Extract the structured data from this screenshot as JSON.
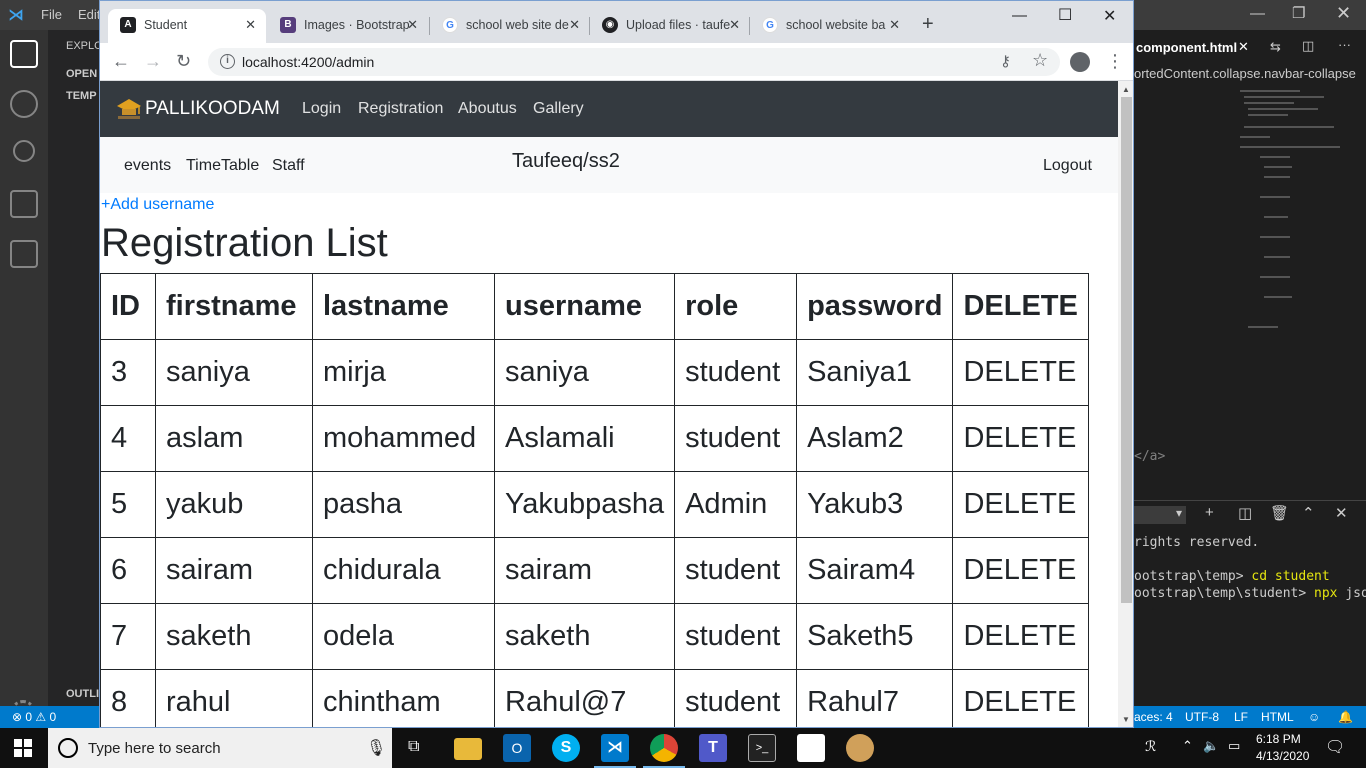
{
  "vscode": {
    "menu_file": "File",
    "menu_edit": "Edit",
    "explorer_label": "EXPLO",
    "open_editors_label": "OPEN",
    "temp_label": "TEMP",
    "outline_label": "OUTLI",
    "editor_tab": "component.html",
    "breadcrumb": "ortedContent.collapse.navbar-collapse",
    "code_snippet": "</a>",
    "terminal_lines": [
      "rights reserved.",
      "ootstrap\\temp> ",
      "ootstrap\\temp\\student> "
    ],
    "terminal_cmd1": "cd student",
    "terminal_cmd2": "npx",
    "terminal_cmd2_rest": " json",
    "status_errors": "0",
    "status_warnings": "0",
    "status_spaces": "aces: 4",
    "status_encoding": "UTF-8",
    "status_eol": "LF",
    "status_lang": "HTML",
    "badge_count": "1"
  },
  "chrome": {
    "tabs": [
      {
        "label": "Student",
        "icon": "angular-icon",
        "color": "#202124"
      },
      {
        "label": "Images · Bootstrap",
        "icon": "bootstrap-icon",
        "color": "#563d7c"
      },
      {
        "label": "school web site de",
        "icon": "google-icon",
        "color": "#4285f4"
      },
      {
        "label": "Upload files · taufe",
        "icon": "github-icon",
        "color": "#202124"
      },
      {
        "label": "school website ba",
        "icon": "google-icon",
        "color": "#4285f4"
      }
    ],
    "url": "localhost:4200/admin"
  },
  "page": {
    "brand": "PALLIKOODAM",
    "nav": {
      "login": "Login",
      "registration": "Registration",
      "aboutus": "Aboutus",
      "gallery": "Gallery"
    },
    "subnav": {
      "events": "events",
      "timetable": "TimeTable",
      "staff": "Staff",
      "title": "Taufeeq/ss2",
      "logout": "Logout"
    },
    "add_link": "+Add username",
    "heading": "Registration List",
    "table": {
      "headers": [
        "ID",
        "firstname",
        "lastname",
        "username",
        "role",
        "password",
        "DELETE"
      ],
      "rows": [
        [
          "3",
          "saniya",
          "mirja",
          "saniya",
          "student",
          "Saniya1",
          "DELETE"
        ],
        [
          "4",
          "aslam",
          "mohammed",
          "Aslamali",
          "student",
          "Aslam2",
          "DELETE"
        ],
        [
          "5",
          "yakub",
          "pasha",
          "Yakubpasha",
          "Admin",
          "Yakub3",
          "DELETE"
        ],
        [
          "6",
          "sairam",
          "chidurala",
          "sairam",
          "student",
          "Sairam4",
          "DELETE"
        ],
        [
          "7",
          "saketh",
          "odela",
          "saketh",
          "student",
          "Saketh5",
          "DELETE"
        ],
        [
          "8",
          "rahul",
          "chintham",
          "Rahul@7",
          "student",
          "Rahul7",
          "DELETE"
        ]
      ]
    }
  },
  "taskbar": {
    "search_placeholder": "Type here to search",
    "time": "6:18 PM",
    "date": "4/13/2020"
  }
}
